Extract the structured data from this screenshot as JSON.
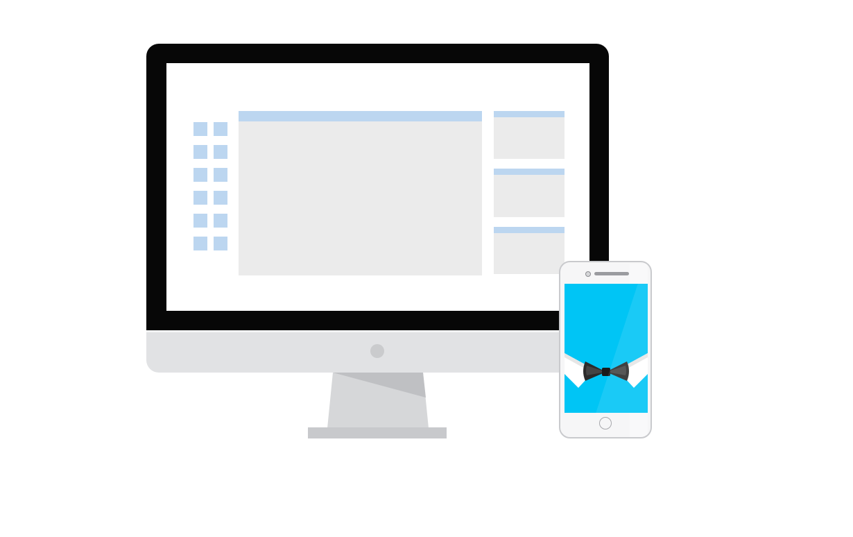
{
  "illustration": {
    "devices": [
      "desktop-monitor",
      "smartphone"
    ],
    "icons": {
      "monitor_power": "power-button-icon",
      "phone_home": "home-button-icon",
      "phone_logo": "bow-tie-icon"
    },
    "colors": {
      "background": "#ffffff",
      "monitor_bezel": "#070707",
      "monitor_body": "#e1e2e4",
      "screen_panel": "#ebebeb",
      "accent_light_blue": "#bcd6f0",
      "phone_screen": "#00c5f5",
      "bow_tie": "#2b2b2b",
      "collar": "#ffffff"
    }
  }
}
